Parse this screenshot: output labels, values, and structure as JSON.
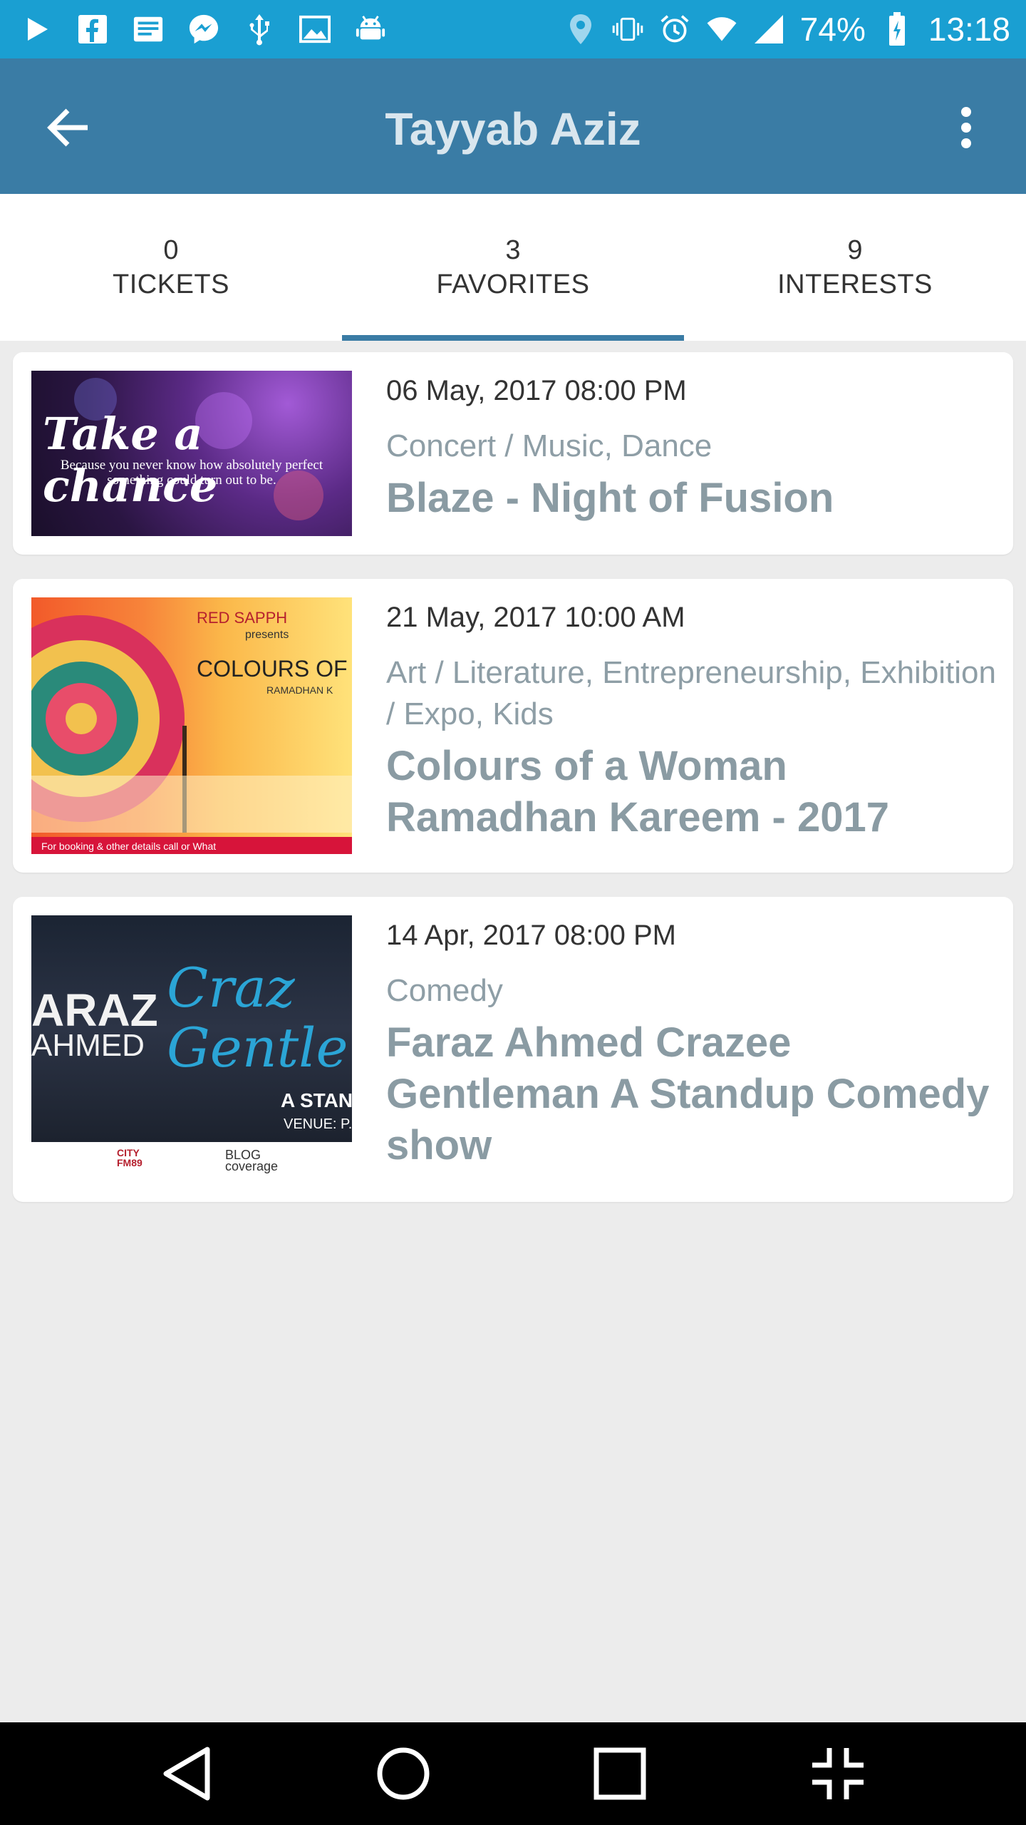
{
  "status_bar": {
    "left_icons": [
      "play-icon",
      "facebook-icon",
      "news-icon",
      "messenger-icon",
      "usb-icon",
      "image-icon",
      "android-icon"
    ],
    "right_icons": [
      "location-icon",
      "vibrate-icon",
      "alarm-icon",
      "wifi-icon",
      "signal-icon",
      "battery-charging-icon"
    ],
    "battery": "74%",
    "time": "13:18"
  },
  "app_bar": {
    "title": "Tayyab Aziz",
    "back_icon": "arrow-back-icon",
    "menu_icon": "more-vert-icon"
  },
  "tabs": [
    {
      "count": "0",
      "label": "TICKETS",
      "selected": false
    },
    {
      "count": "3",
      "label": "FAVORITES",
      "selected": true
    },
    {
      "count": "9",
      "label": "INTERESTS",
      "selected": false
    }
  ],
  "events": [
    {
      "date": "06 May, 2017 08:00 PM",
      "category": "Concert / Music, Dance",
      "title": "Blaze - Night of Fusion",
      "thumb_heading": "Take a chance",
      "thumb_sub": "Because you never know how absolutely perfect something could turn out to be."
    },
    {
      "date": "21 May, 2017 10:00 AM",
      "category": "Art / Literature, Entrepreneurship, Exhibition / Expo, Kids",
      "title": "Colours of a Woman Ramadhan Kareem - 2017",
      "thumb_brand": "RED SAPPH",
      "thumb_presents": "presents",
      "thumb_heading": "COLOURS OF A",
      "thumb_sub": "RAMADHAN K",
      "thumb_footer": "For booking & other details call or What"
    },
    {
      "date": "14 Apr, 2017 08:00 PM",
      "category": "Comedy",
      "title": "Faraz Ahmed Crazee Gentleman A Standup Comedy show",
      "thumb_name1": "ARAZ",
      "thumb_name2": "AHMED",
      "thumb_neon": "Craz Gentle",
      "thumb_standup": "A STAND-",
      "thumb_venue": "VENUE: P.A.C",
      "thumb_logo1": "CITY FM89",
      "thumb_logo2": "BLOG coverage"
    }
  ],
  "nav_bar": {
    "icons": [
      "nav-back-icon",
      "nav-home-icon",
      "nav-recents-icon",
      "nav-fullscreen-exit-icon"
    ]
  }
}
